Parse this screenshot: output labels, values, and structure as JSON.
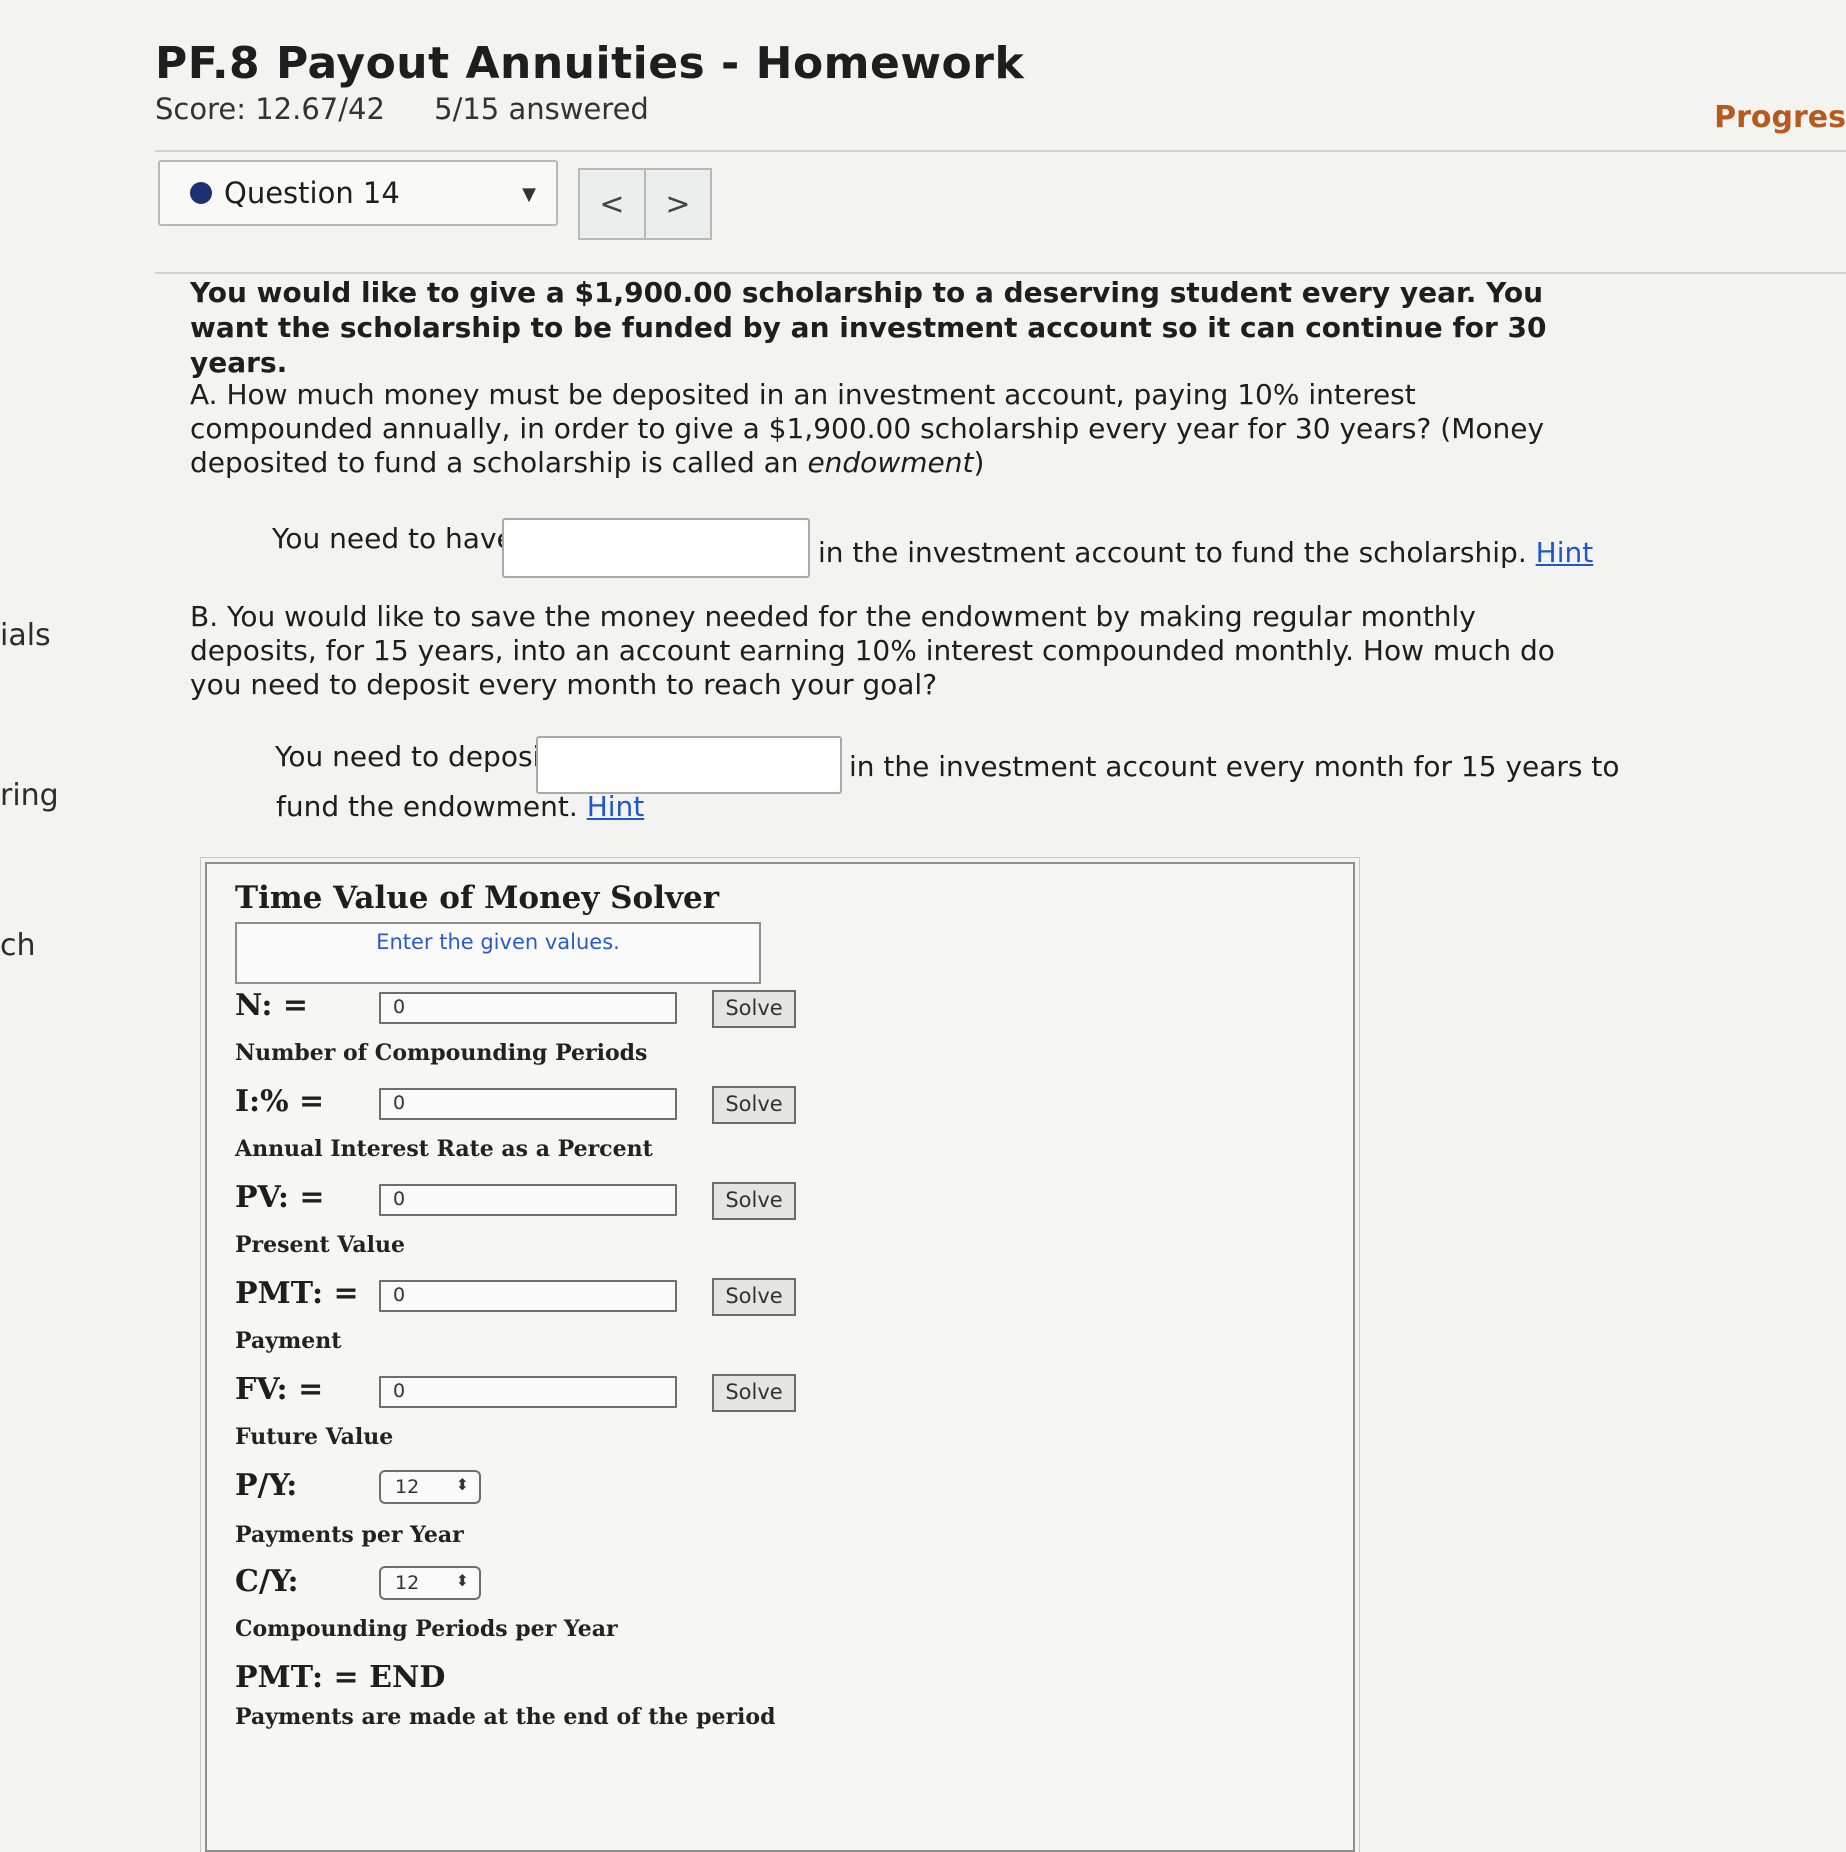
{
  "sidebar": [
    "ials",
    "ring",
    "ch"
  ],
  "header": {
    "title": "PF.8 Payout Annuities - Homework",
    "score": "Score: 12.67/42",
    "answered": "5/15 answered",
    "progress": "Progres"
  },
  "question_nav": {
    "current": "Question 14",
    "prev_glyph": "<",
    "next_glyph": ">"
  },
  "question": {
    "intro": "You would like to give a $1,900.00 scholarship to a deserving student every year. You want the scholarship to be funded by an investment account so it can continue for 30 years.",
    "part_a_text": "A. How much money must be deposited in an investment account, paying 10% interest compounded annually, in order to give a $1,900.00 scholarship every year for 30 years? (Money deposited to fund a scholarship is called an",
    "part_a_em": "endowment",
    "part_a_close": ")",
    "part_a_prefix": "You need to have",
    "part_a_suffix": "in the investment account to fund the scholarship.",
    "part_a_value": "",
    "part_b_text": "B. You would like to save the money needed for the endowment by making regular monthly deposits, for 15 years, into an account earning 10% interest compounded monthly. How much do you need to deposit every month to reach your goal?",
    "part_b_prefix": "You need to deposit",
    "part_b_suffix": "in the investment account every month for 15 years to",
    "part_b_line2": "fund the endowment.",
    "part_b_value": "",
    "hint_label": "Hint"
  },
  "solver": {
    "title": "Time Value of Money Solver",
    "message": "Enter the given values.",
    "solve_label": "Solve",
    "rows": [
      {
        "label": "N: =",
        "desc": "Number of Compounding Periods",
        "value": "0"
      },
      {
        "label": "I:% =",
        "desc": "Annual Interest Rate as a Percent",
        "value": "0"
      },
      {
        "label": "PV: =",
        "desc": "Present Value",
        "value": "0"
      },
      {
        "label": "PMT: =",
        "desc": "Payment",
        "value": "0"
      },
      {
        "label": "FV: =",
        "desc": "Future Value",
        "value": "0"
      }
    ],
    "py": {
      "label": "P/Y:",
      "desc": "Payments per Year",
      "value": "12"
    },
    "cy": {
      "label": "C/Y:",
      "desc": "Compounding Periods per Year",
      "value": "12"
    },
    "pmt_mode": {
      "label": "PMT: = END",
      "desc": "Payments are made at the end of the period"
    }
  }
}
